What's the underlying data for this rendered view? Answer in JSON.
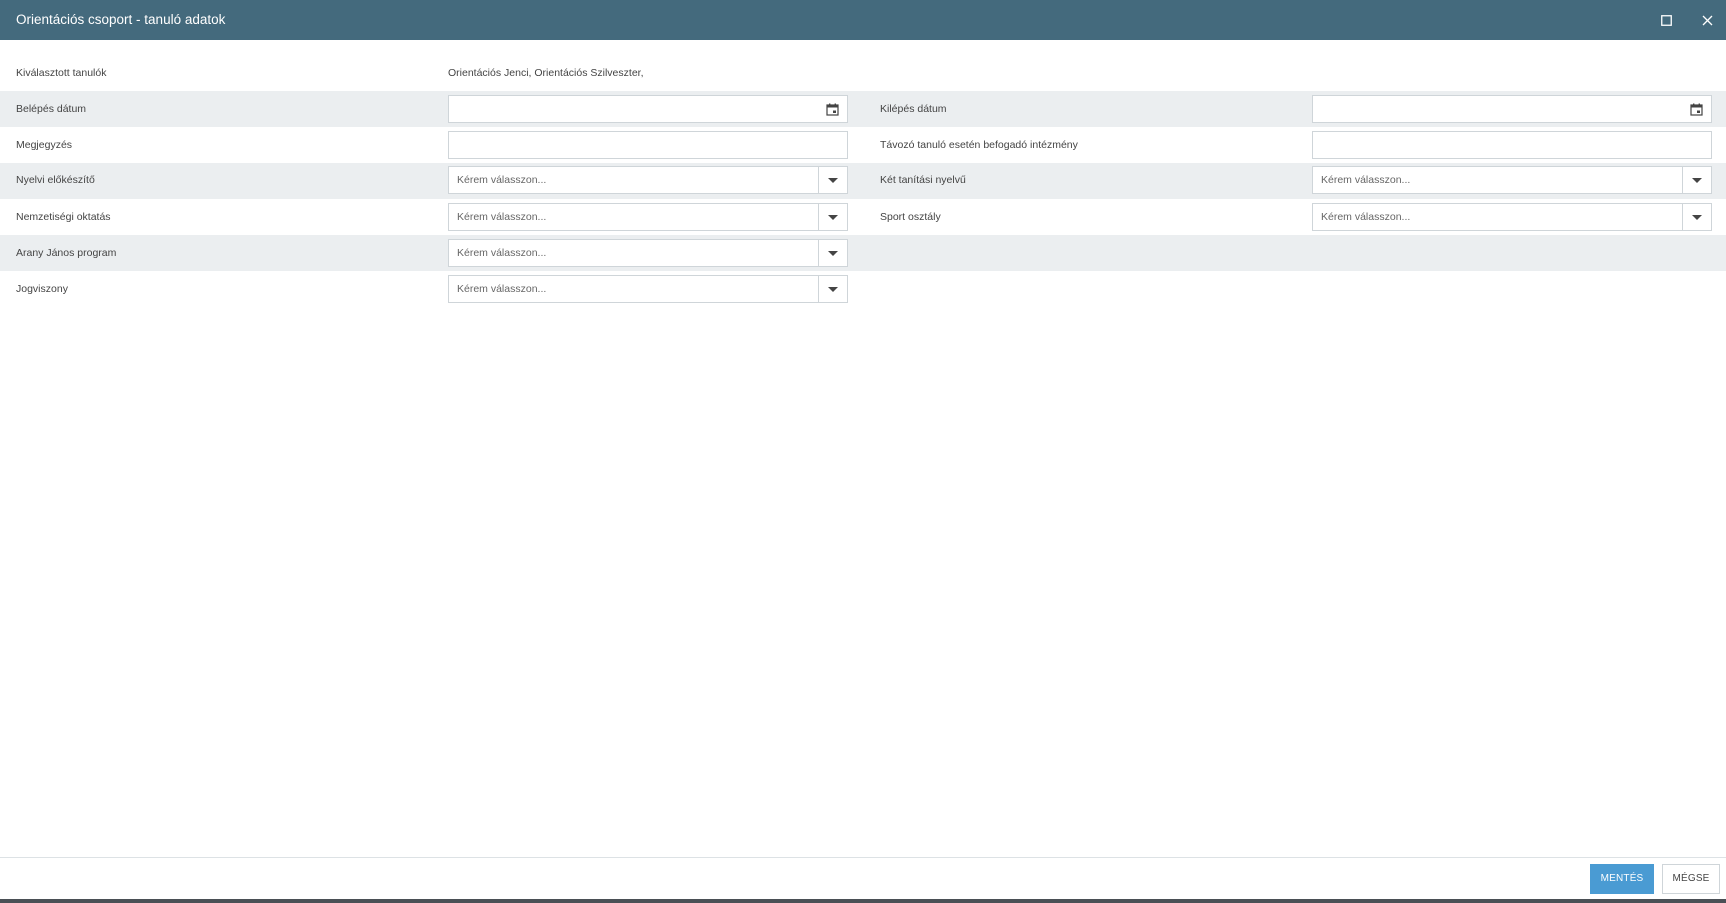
{
  "dialog": {
    "title": "Orientációs csoport - tanuló adatok",
    "maximize_icon": "maximize-icon",
    "close_icon": "close-icon"
  },
  "form": {
    "selected_students_label": "Kiválasztott tanulók",
    "selected_students_value": "Orientációs Jenci, Orientációs Szilveszter,",
    "entry_date_label": "Belépés dátum",
    "entry_date_value": "",
    "exit_date_label": "Kilépés dátum",
    "exit_date_value": "",
    "note_label": "Megjegyzés",
    "note_value": "",
    "receiving_institution_label": "Távozó tanuló esetén befogadó intézmény",
    "receiving_institution_value": "",
    "language_prep_label": "Nyelvi előkészítő",
    "language_prep_value": "Kérem válasszon...",
    "bilingual_label": "Két tanítási nyelvű",
    "bilingual_value": "Kérem válasszon...",
    "nationality_education_label": "Nemzetiségi oktatás",
    "nationality_education_value": "Kérem válasszon...",
    "sport_class_label": "Sport osztály",
    "sport_class_value": "Kérem válasszon...",
    "arany_janos_label": "Arany János program",
    "arany_janos_value": "Kérem válasszon...",
    "legal_relation_label": "Jogviszony",
    "legal_relation_value": "Kérem válasszon..."
  },
  "footer": {
    "save_label": "MENTÉS",
    "cancel_label": "MÉGSE"
  },
  "colors": {
    "titlebar": "#446a7d",
    "row_shade": "#ebeef0",
    "primary_button": "#4a9bd3"
  }
}
